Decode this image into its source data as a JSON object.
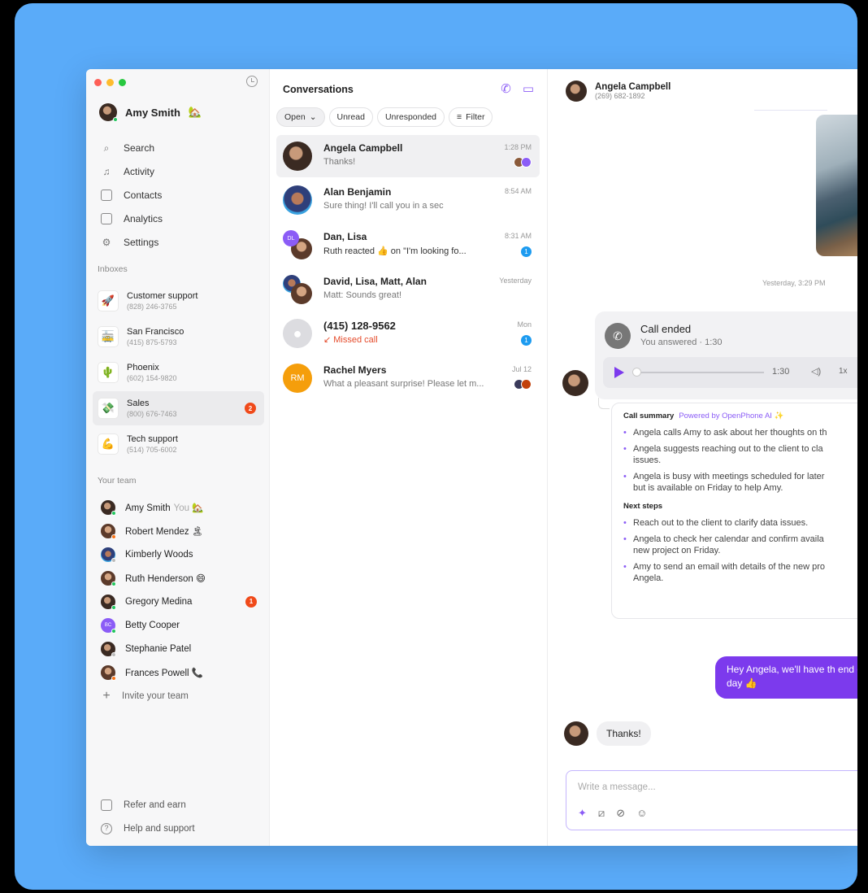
{
  "user": {
    "name": "Amy Smith",
    "emoji": "🏡"
  },
  "nav": [
    {
      "label": "Search",
      "icon": "🔍"
    },
    {
      "label": "Activity",
      "icon": "🔔"
    },
    {
      "label": "Contacts",
      "icon": "▤"
    },
    {
      "label": "Analytics",
      "icon": "📈"
    },
    {
      "label": "Settings",
      "icon": "⚙"
    }
  ],
  "inboxes_label": "Inboxes",
  "inboxes": [
    {
      "name": "Customer support",
      "phone": "(828) 246-3765",
      "emoji": "🚀"
    },
    {
      "name": "San Francisco",
      "phone": "(415) 875-5793",
      "emoji": "🚋"
    },
    {
      "name": "Phoenix",
      "phone": "(602) 154-9820",
      "emoji": "🌵"
    },
    {
      "name": "Sales",
      "phone": "(800) 676-7463",
      "emoji": "💸",
      "badge": "2"
    },
    {
      "name": "Tech support",
      "phone": "(514) 705-6002",
      "emoji": "💪"
    }
  ],
  "team_label": "Your team",
  "team": [
    {
      "name": "Amy Smith",
      "you": "You",
      "emoji": "🏡"
    },
    {
      "name": "Robert Mendez",
      "emoji": "🏝"
    },
    {
      "name": "Kimberly Woods",
      "emoji": ""
    },
    {
      "name": "Ruth Henderson",
      "emoji": "😄"
    },
    {
      "name": "Gregory Medina",
      "emoji": "",
      "badge": "1"
    },
    {
      "name": "Betty Cooper",
      "emoji": "",
      "initials": "BC"
    },
    {
      "name": "Stephanie Patel",
      "emoji": ""
    },
    {
      "name": "Frances Powell",
      "emoji": "📞"
    }
  ],
  "invite_label": "Invite your team",
  "refer_label": "Refer and earn",
  "help_label": "Help and support",
  "conversations": {
    "title": "Conversations",
    "filters": {
      "open": "Open",
      "unread": "Unread",
      "unresponded": "Unresponded",
      "filter": "Filter"
    },
    "items": [
      {
        "name": "Angela Campbell",
        "preview": "Thanks!",
        "time": "1:28 PM"
      },
      {
        "name": "Alan Benjamin",
        "preview": "Sure thing! I'll call you in a sec",
        "time": "8:54 AM"
      },
      {
        "name": "Dan, Lisa",
        "preview": "Ruth reacted 👍 on \"I'm looking fo...",
        "time": "8:31 AM",
        "unread": "1"
      },
      {
        "name": "David, Lisa, Matt, Alan",
        "preview": "Matt: Sounds great!",
        "time": "Yesterday"
      },
      {
        "name": "(415) 128-9562",
        "preview": "↙ Missed call",
        "time": "Mon",
        "unread": "1"
      },
      {
        "name": "Rachel Myers",
        "preview": "What a pleasant surprise! Please let m...",
        "time": "Jul 12",
        "initials": "RM"
      }
    ]
  },
  "chat": {
    "contact_name": "Angela Campbell",
    "contact_phone": "(269) 682-1892",
    "timestamp": "Yesterday, 3:29 PM",
    "call_title": "Call ended",
    "call_sub": "You answered · 1:30",
    "player_time": "1:30",
    "player_speed": "1x",
    "summary_title": "Call summary",
    "summary_powered": "Powered by OpenPhone AI ✨",
    "summary_points": [
      "Angela calls Amy to ask about her thoughts on th",
      "Angela suggests reaching out to the client to cla",
      "issues.",
      "Angela is busy with meetings scheduled for later",
      "but is available on Friday to help Amy."
    ],
    "next_steps_title": "Next steps",
    "next_steps": [
      "Reach out to the client to clarify data issues.",
      "Angela to check her calendar and confirm availa",
      "new project on Friday.",
      "Amy to send an email with details of the new pro",
      "Angela."
    ],
    "outgoing": "Hey Angela, we'll have th end of day 👍",
    "incoming": "Thanks!",
    "composer_placeholder": "Write a message..."
  },
  "colors": {
    "accent": "#7c3aed",
    "backdrop": "#5aabf9",
    "alert": "#f04a1a",
    "unread": "#1d9bf0"
  }
}
